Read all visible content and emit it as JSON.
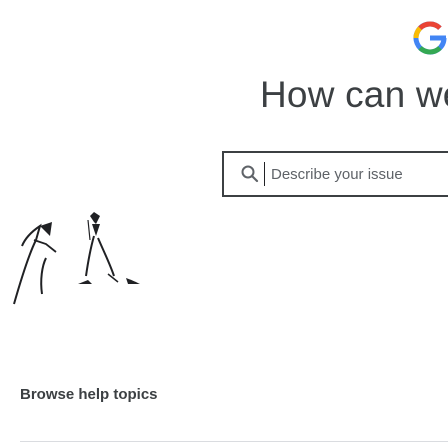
{
  "brand": {
    "logo_icon": "google-g-icon",
    "colors": {
      "blue": "#4285F4",
      "red": "#EA4335",
      "yellow": "#FBBC05",
      "green": "#34A853"
    }
  },
  "hero": {
    "title": "How can we"
  },
  "search": {
    "icon": "search-icon",
    "placeholder": "Describe your issue",
    "value": ""
  },
  "browse": {
    "title": "Browse help topics"
  }
}
